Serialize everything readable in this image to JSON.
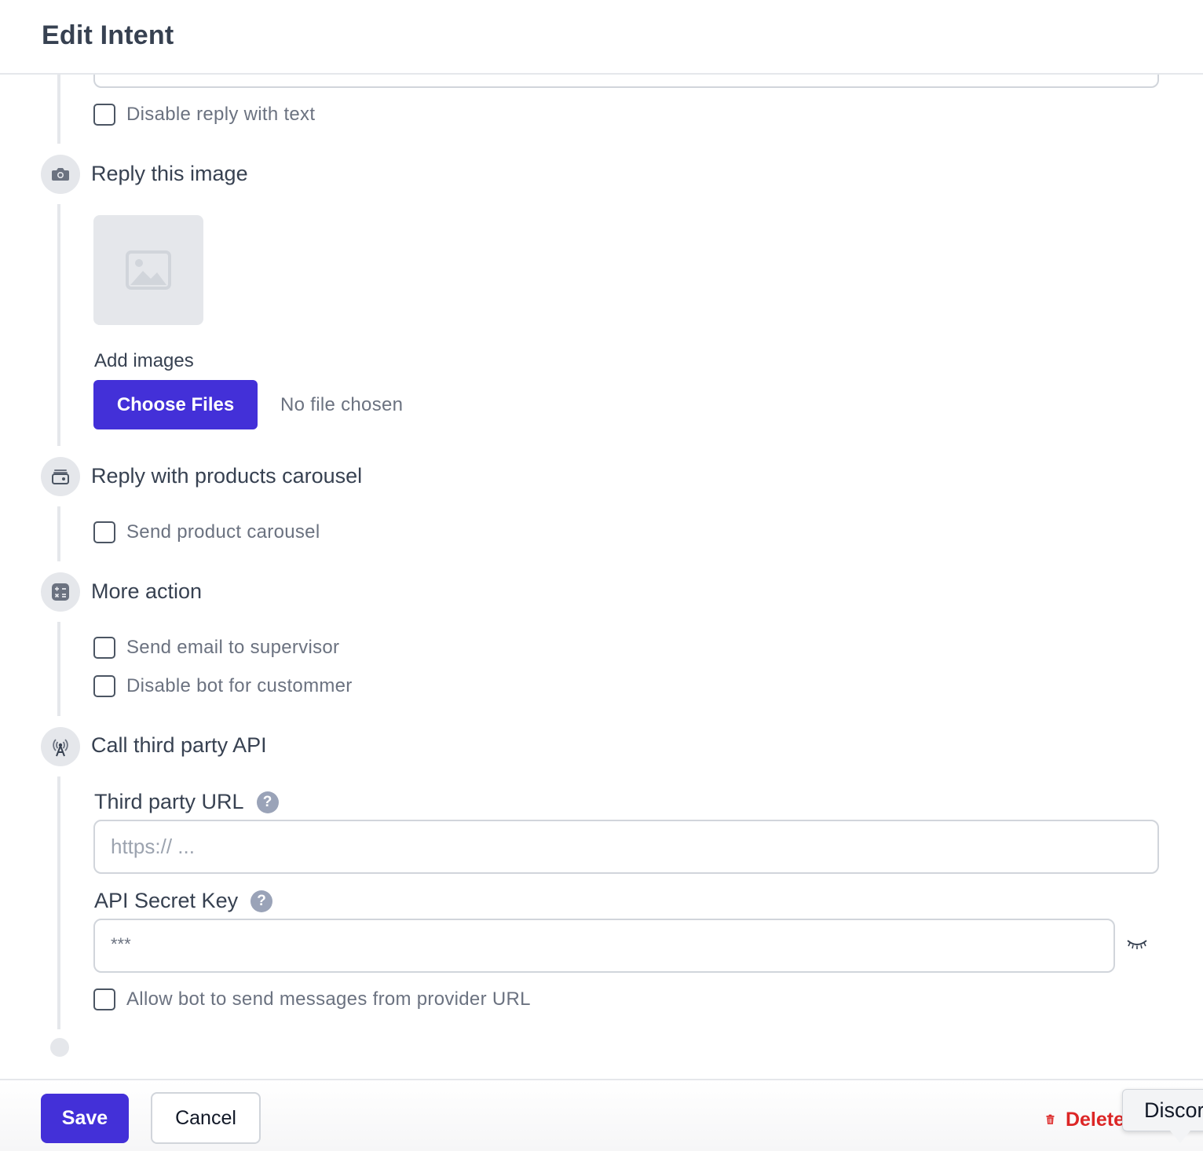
{
  "header": {
    "title": "Edit Intent"
  },
  "text_section": {
    "disable_reply_label": "Disable reply with text"
  },
  "image_section": {
    "title": "Reply this image",
    "icon": "camera-icon",
    "add_images_label": "Add images",
    "choose_files_label": "Choose Files",
    "no_file_text": "No file chosen"
  },
  "carousel_section": {
    "title": "Reply with products carousel",
    "icon": "wallet-icon",
    "send_carousel_label": "Send product carousel"
  },
  "more_action_section": {
    "title": "More action",
    "icon": "calculator-icon",
    "send_email_label": "Send email to supervisor",
    "disable_bot_label": "Disable bot for custommer"
  },
  "api_section": {
    "title": "Call third party API",
    "icon": "broadcast-tower-icon",
    "url_label": "Third party URL",
    "url_placeholder": "https:// ...",
    "secret_label": "API Secret Key",
    "secret_placeholder": "***",
    "help_glyph": "?",
    "allow_bot_label": "Allow bot to send messages from provider URL"
  },
  "footer": {
    "save_label": "Save",
    "cancel_label": "Cancel",
    "delete_label": "Delete",
    "tooltip_text": "Discord"
  },
  "colors": {
    "primary": "#4330d8",
    "danger": "#dc2626",
    "rail": "#e5e7eb"
  }
}
